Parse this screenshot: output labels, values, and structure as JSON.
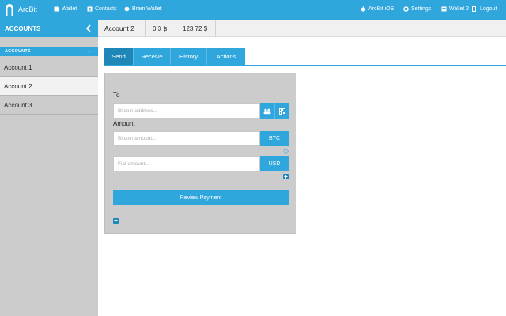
{
  "nav": {
    "brand": "ArcBit",
    "wallet": "Wallet",
    "contacts": "Contacts",
    "brain_wallet": "Brain Wallet",
    "ios": "ArcBit iOS",
    "settings": "Settings",
    "wallet2": "Wallet 2",
    "logout": "Logout"
  },
  "sidebar": {
    "header": "ACCOUNTS",
    "section": "ACCOUNTS",
    "add": "+",
    "accounts": [
      "Account 1",
      "Account 2",
      "Account 3"
    ],
    "selected_index": 1
  },
  "account_bar": {
    "name": "Account 2",
    "btc_balance": "0.3 ฿",
    "fiat_balance": "123.72 $"
  },
  "tabs": [
    "Send",
    "Receive",
    "History",
    "Actions"
  ],
  "active_tab": "Send",
  "send": {
    "to_label": "To",
    "to_placeholder": "Bitcoin address...",
    "amount_label": "Amount",
    "btc_placeholder": "Bitcoin amount...",
    "btc_unit": "BTC",
    "fiat_placeholder": "Fiat amount...",
    "fiat_unit": "USD",
    "review": "Review Payment"
  },
  "colors": {
    "accent": "#2fa6dc",
    "active_tab": "#1e87b8",
    "panel": "#cccccc"
  },
  "icons": [
    "arcbit-logo-icon",
    "wallet-icon",
    "contacts-icon",
    "brain-icon",
    "apple-icon",
    "gear-icon",
    "wallet-icon",
    "logout-icon",
    "chevron-left-icon",
    "contacts-picker-icon",
    "qr-icon",
    "swap-icon",
    "plus-icon",
    "minus-icon"
  ]
}
